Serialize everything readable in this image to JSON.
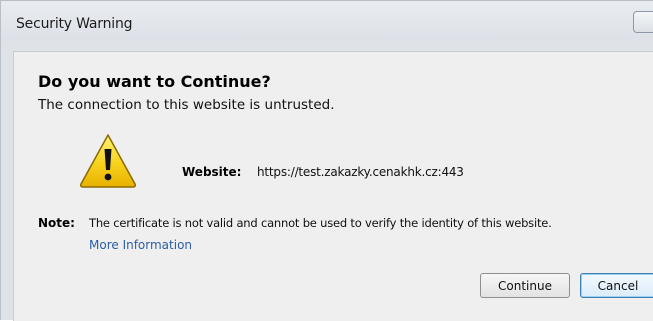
{
  "window": {
    "title": "Security Warning"
  },
  "dialog": {
    "heading": "Do you want to Continue?",
    "subheading": "The connection to this website is untrusted.",
    "website_label": "Website:",
    "website_value": "https://test.zakazky.cenakhk.cz:443",
    "note_label": "Note:",
    "note_text": "The certificate is not valid and cannot be used to verify the identity of this website.",
    "more_info_link": "More Information",
    "icon": "warning-triangle-icon"
  },
  "buttons": {
    "continue_label": "Continue",
    "cancel_label": "Cancel"
  },
  "colors": {
    "link": "#2d5ea8",
    "warning_yellow": "#f7d21c",
    "default_button_border": "#3c7fb1"
  }
}
